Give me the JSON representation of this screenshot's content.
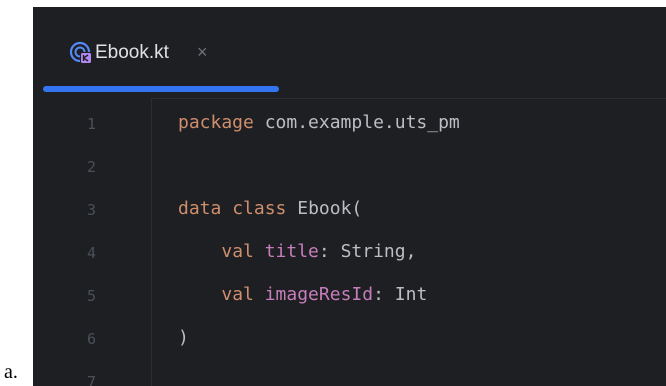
{
  "outer_label": "a.",
  "tab": {
    "file_name": "Ebook.kt",
    "close_glyph": "×",
    "icon": "kotlin-class-file-icon"
  },
  "line_numbers": [
    "1",
    "2",
    "3",
    "4",
    "5",
    "6",
    "7"
  ],
  "code": {
    "line1": {
      "keyword": "package",
      "rest": " com.example.uts_pm"
    },
    "line3": {
      "keyword1": "data",
      "keyword2": " class",
      "rest": " Ebook("
    },
    "line4": {
      "indent": "    ",
      "keyword": "val",
      "prop": " title",
      "rest": ": String,"
    },
    "line5": {
      "indent": "    ",
      "keyword": "val",
      "prop": " imageResId",
      "rest": ": Int"
    },
    "line6": {
      "rest": ")"
    }
  },
  "colors": {
    "editor_background": "#1e1f22",
    "keyword": "#cf8e6d",
    "property": "#c77dbb",
    "text": "#bcbec4",
    "line_number": "#4b5059",
    "active_tab_underline": "#3574f0"
  }
}
